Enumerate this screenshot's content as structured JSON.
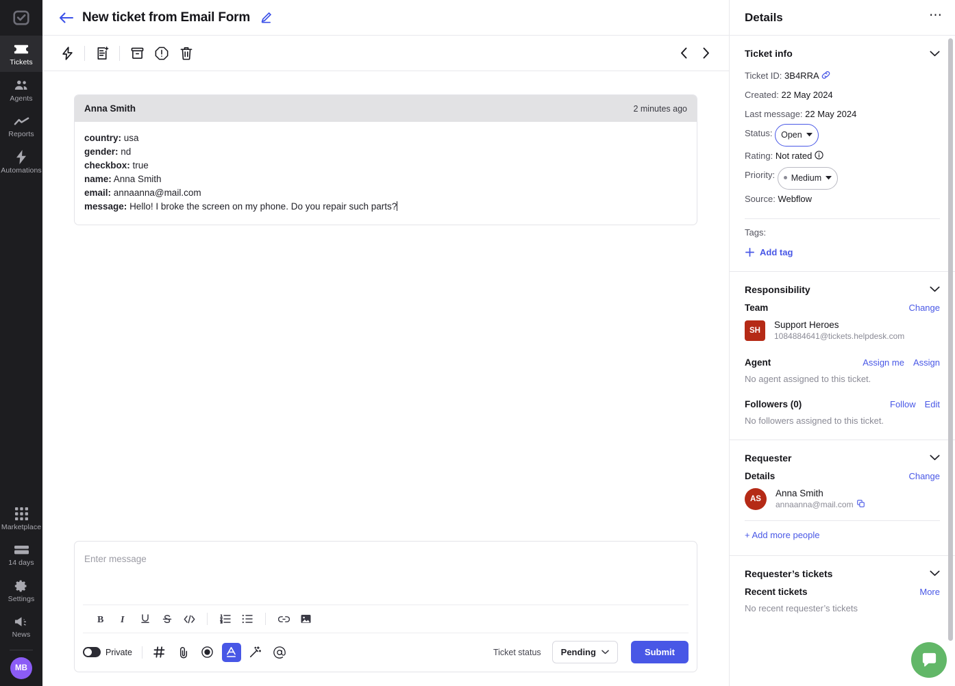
{
  "rail": {
    "logo_icon": "checkbox-logo-icon",
    "items": [
      {
        "label": "Tickets",
        "icon": "ticket-icon",
        "active": true
      },
      {
        "label": "Agents",
        "icon": "agents-icon",
        "active": false
      },
      {
        "label": "Reports",
        "icon": "reports-chart-icon",
        "active": false
      },
      {
        "label": "Automations",
        "icon": "automations-bolt-icon",
        "active": false
      }
    ],
    "bottom_items": [
      {
        "label": "Marketplace",
        "icon": "marketplace-grid-icon"
      },
      {
        "label": "14 days",
        "icon": "trial-card-icon"
      },
      {
        "label": "Settings",
        "icon": "gear-icon"
      },
      {
        "label": "News",
        "icon": "megaphone-icon"
      }
    ],
    "avatar_initials": "MB"
  },
  "topbar": {
    "back_icon": "back-arrow-icon",
    "title": "New ticket from Email Form",
    "edit_icon": "edit-pencil-icon"
  },
  "toolbar": {
    "buttons": [
      {
        "name": "quick-actions-bolt-icon"
      },
      {
        "name": "add-note-icon"
      },
      {
        "name": "archive-icon"
      },
      {
        "name": "report-spam-icon"
      },
      {
        "name": "delete-trash-icon"
      }
    ],
    "prev_icon": "chevron-left-icon",
    "next_icon": "chevron-right-icon"
  },
  "message": {
    "author": "Anna Smith",
    "time": "2 minutes ago",
    "fields": [
      {
        "key": "country:",
        "value": "usa"
      },
      {
        "key": "gender:",
        "value": "nd"
      },
      {
        "key": "checkbox:",
        "value": "true"
      },
      {
        "key": "name:",
        "value": "Anna Smith"
      },
      {
        "key": "email:",
        "value": "annaanna@mail.com"
      },
      {
        "key": "message:",
        "value": "Hello! I broke the screen on my phone. Do you repair such parts?"
      }
    ]
  },
  "composer": {
    "placeholder": "Enter message",
    "rich_text_buttons": [
      {
        "name": "bold-icon",
        "glyph": "B"
      },
      {
        "name": "italic-icon",
        "glyph": "I"
      },
      {
        "name": "underline-icon",
        "glyph": "U"
      },
      {
        "name": "strikethrough-icon",
        "glyph": "S"
      },
      {
        "name": "code-icon",
        "glyph": "</>"
      },
      {
        "name": "ordered-list-icon",
        "glyph": ""
      },
      {
        "name": "bullet-list-icon",
        "glyph": ""
      },
      {
        "name": "link-icon",
        "glyph": ""
      },
      {
        "name": "image-icon",
        "glyph": ""
      }
    ],
    "private_label": "Private",
    "private_on": false,
    "footer_buttons": [
      {
        "name": "canned-response-hash-icon"
      },
      {
        "name": "attachment-paperclip-icon"
      },
      {
        "name": "record-icon"
      },
      {
        "name": "text-color-icon",
        "active": true
      },
      {
        "name": "ai-magic-wand-icon"
      },
      {
        "name": "mention-at-icon"
      }
    ],
    "ticket_status_label": "Ticket status",
    "ticket_status_value": "Pending",
    "submit_label": "Submit"
  },
  "details": {
    "title": "Details",
    "more_icon": "more-dots-icon",
    "ticket_info": {
      "title": "Ticket info",
      "ticket_id_label": "Ticket ID:",
      "ticket_id_value": "3B4RRA",
      "copy_link_icon": "link-chain-icon",
      "created_label": "Created:",
      "created_value": "22 May 2024",
      "last_message_label": "Last message:",
      "last_message_value": "22 May 2024",
      "status_label": "Status:",
      "status_value": "Open",
      "rating_label": "Rating:",
      "rating_value": "Not rated",
      "rating_info_icon": "info-circle-icon",
      "priority_label": "Priority:",
      "priority_value": "Medium",
      "source_label": "Source:",
      "source_value": "Webflow",
      "tags_label": "Tags:",
      "add_tag_label": "Add tag"
    },
    "responsibility": {
      "title": "Responsibility",
      "team_label": "Team",
      "team_change_link": "Change",
      "team_initials": "SH",
      "team_name": "Support Heroes",
      "team_email": "1084884641@tickets.helpdesk.com",
      "agent_label": "Agent",
      "agent_assign_me_link": "Assign me",
      "agent_assign_link": "Assign",
      "agent_empty": "No agent assigned to this ticket.",
      "followers_label": "Followers (0)",
      "followers_follow_link": "Follow",
      "followers_edit_link": "Edit",
      "followers_empty": "No followers assigned to this ticket."
    },
    "requester": {
      "title": "Requester",
      "details_label": "Details",
      "change_link": "Change",
      "initials": "AS",
      "name": "Anna Smith",
      "email": "annaanna@mail.com",
      "copy_icon": "copy-icon",
      "add_people_link": "+ Add more people"
    },
    "requester_tickets": {
      "title": "Requester’s tickets",
      "recent_label": "Recent tickets",
      "more_link": "More",
      "empty": "No recent requester’s tickets"
    },
    "chat_fab_icon": "chat-bubble-icon"
  },
  "colors": {
    "accent": "#4857e6",
    "rail_bg": "#1d1d20",
    "team_avatar": "#b52a16",
    "user_avatar": "#8b5cf6",
    "chat_fab": "#62b768"
  }
}
